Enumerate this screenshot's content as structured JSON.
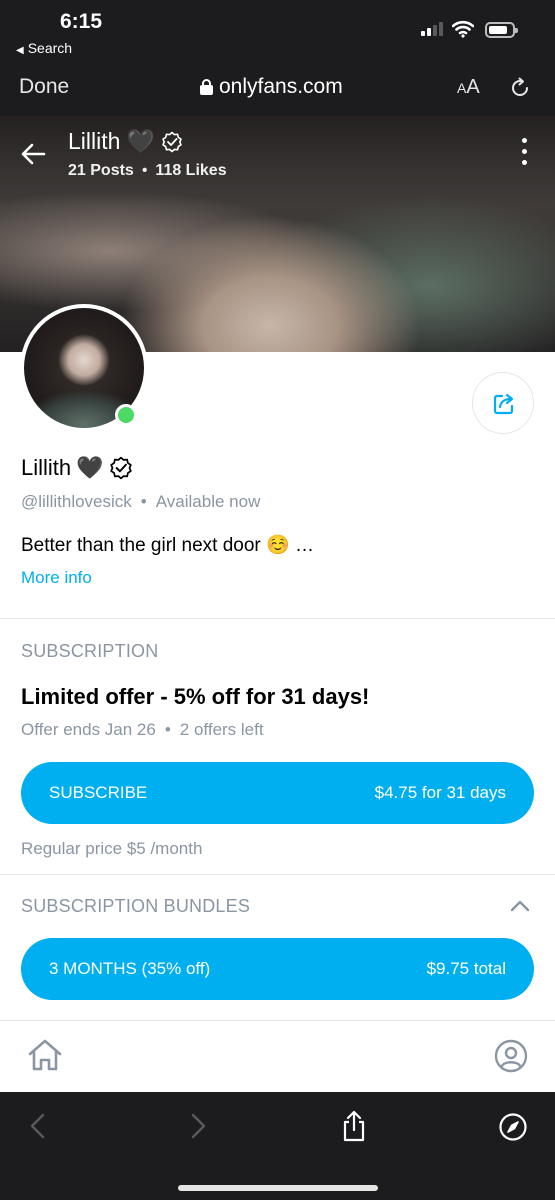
{
  "status_bar": {
    "time": "6:15",
    "back_app": "Search"
  },
  "browser": {
    "done_label": "Done",
    "url": "onlyfans.com",
    "text_size_label": "AA"
  },
  "profile": {
    "name": "Lillith",
    "name_emoji": "🖤",
    "posts": "21 Posts",
    "likes": "118 Likes",
    "username": "@lillithlovesick",
    "availability": "Available now",
    "bio": "Better than the girl next door ☺️ …",
    "more_info": "More info",
    "online": true
  },
  "subscription": {
    "section_title": "SUBSCRIPTION",
    "offer_title": "Limited offer - 5% off for 31 days!",
    "offer_ends": "Offer ends Jan 26",
    "offers_left": "2 offers left",
    "subscribe_label": "SUBSCRIBE",
    "subscribe_price": "$4.75 for 31 days",
    "regular_price": "Regular price $5 /month"
  },
  "bundles": {
    "section_title": "SUBSCRIPTION BUNDLES",
    "expanded": true,
    "items": [
      {
        "label": "3 MONTHS (35% off)",
        "price": "$9.75 total"
      }
    ]
  },
  "colors": {
    "accent": "#00aff0",
    "muted_text": "#8a96a3",
    "online": "#4cd964",
    "chrome": "#1c1c1e"
  },
  "icons": {
    "back": "arrow-left-icon",
    "verified": "verified-badge-icon",
    "more": "kebab-menu-icon",
    "share": "share-icon",
    "home": "home-icon",
    "profile": "user-circle-icon",
    "safari_back": "chevron-left-icon",
    "safari_forward": "chevron-right-icon",
    "safari_share": "share-upload-icon",
    "safari_compass": "compass-icon"
  }
}
